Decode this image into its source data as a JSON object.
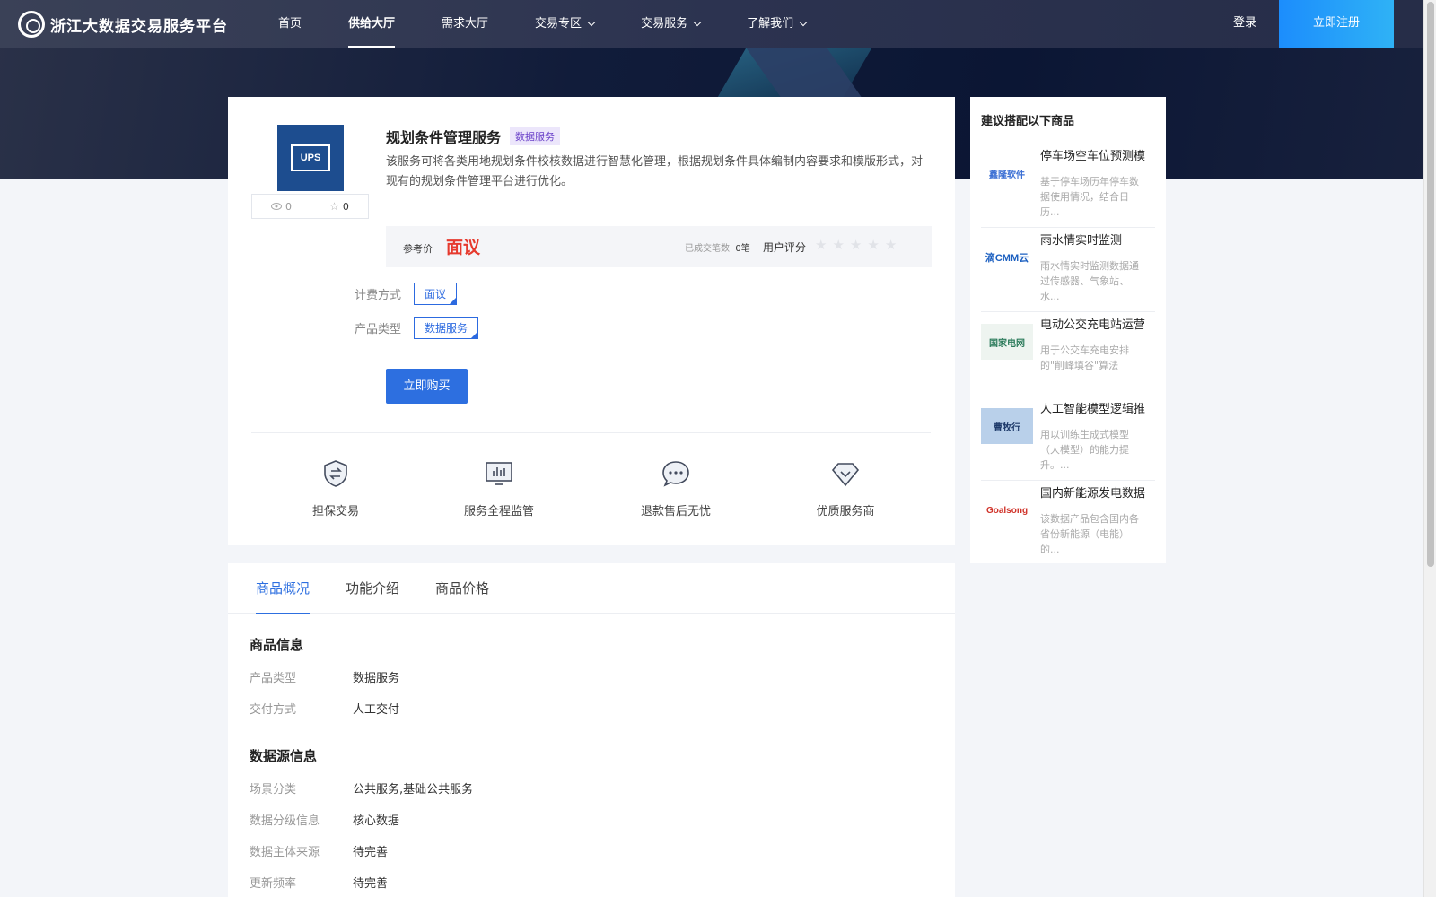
{
  "nav": {
    "logo_text": "浙江大数据交易服务平台",
    "items": [
      {
        "label": "首页"
      },
      {
        "label": "供给大厅"
      },
      {
        "label": "需求大厅"
      },
      {
        "label": "交易专区"
      },
      {
        "label": "交易服务"
      },
      {
        "label": "了解我们"
      }
    ],
    "login": "登录",
    "register": "立即注册"
  },
  "product": {
    "image_text": "UPS",
    "views": "0",
    "favorites": "0",
    "title": "规划条件管理服务",
    "tag": "数据服务",
    "description": "该服务可将各类用地规划条件校核数据进行智慧化管理，根据规划条件具体编制内容要求和模版形式，对现有的规划条件管理平台进行优化。",
    "price_label": "参考价",
    "price_value": "面议",
    "deals_label": "已成交笔数",
    "deals_value": "0笔",
    "rating_label": "用户评分",
    "rating": 0,
    "billing_label": "计费方式",
    "billing_value": "面议",
    "type_label": "产品类型",
    "type_value": "数据服务",
    "buy_button": "立即购买"
  },
  "features": [
    {
      "label": "担保交易",
      "icon": "shield-exchange-icon"
    },
    {
      "label": "服务全程监管",
      "icon": "monitor-chart-icon"
    },
    {
      "label": "退款售后无忧",
      "icon": "chat-bubble-icon"
    },
    {
      "label": "优质服务商",
      "icon": "diamond-check-icon"
    }
  ],
  "tabs": [
    {
      "label": "商品概况"
    },
    {
      "label": "功能介绍"
    },
    {
      "label": "商品价格"
    }
  ],
  "product_info": {
    "title": "商品信息",
    "rows": [
      {
        "k": "产品类型",
        "v": "数据服务"
      },
      {
        "k": "交付方式",
        "v": "人工交付"
      }
    ]
  },
  "source_info": {
    "title": "数据源信息",
    "rows": [
      {
        "k": "场景分类",
        "v": "公共服务,基础公共服务"
      },
      {
        "k": "数据分级信息",
        "v": "核心数据"
      },
      {
        "k": "数据主体来源",
        "v": "待完善"
      },
      {
        "k": "更新频率",
        "v": "待完善"
      }
    ]
  },
  "sidebar": {
    "title": "建议搭配以下商品",
    "items": [
      {
        "name": "停车场空车位预测模",
        "desc": "基于停车场历年停车数据使用情况，结合日历...",
        "thumb": "鑫隆软件",
        "color": "#3b6fd4"
      },
      {
        "name": "雨水情实时监测",
        "desc": "雨水情实时监测数据通过传感器、气象站、水...",
        "thumb": "滴CMM云",
        "color": "#1b5fc0"
      },
      {
        "name": "电动公交充电站运营",
        "desc": "用于公交车充电安排的\"削峰填谷\"算法",
        "thumb": "国家电网",
        "color": "#2a7a5a"
      },
      {
        "name": "人工智能模型逻辑推",
        "desc": "用以训练生成式模型（大模型）的能力提升。...",
        "thumb": "曹牧行",
        "color": "#1e3a6a"
      },
      {
        "name": "国内新能源发电数据",
        "desc": "该数据产品包含国内各省份新能源（电能）的...",
        "thumb": "Goalsong",
        "color": "#d0332a"
      }
    ]
  }
}
